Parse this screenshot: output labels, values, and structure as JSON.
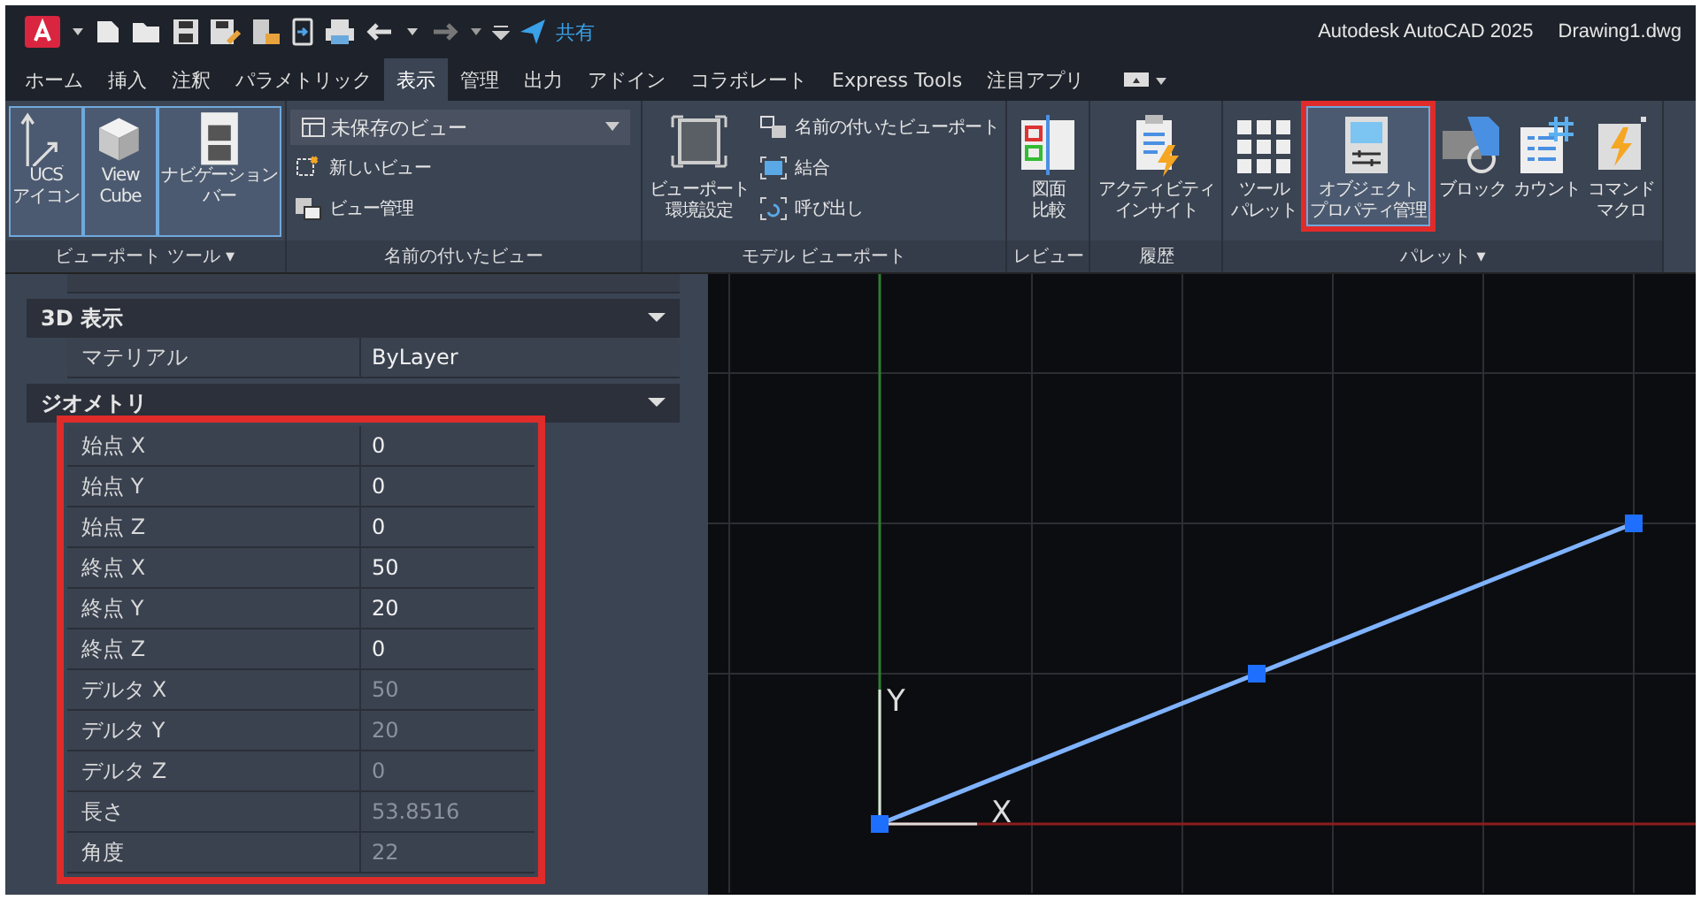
{
  "title_bar": {
    "share_label": "共有",
    "app_title": "Autodesk AutoCAD 2025",
    "document_title": "Drawing1.dwg"
  },
  "tabs": [
    {
      "label": "ホーム",
      "selected": false
    },
    {
      "label": "挿入",
      "selected": false
    },
    {
      "label": "注釈",
      "selected": false
    },
    {
      "label": "パラメトリック",
      "selected": false
    },
    {
      "label": "表示",
      "selected": true
    },
    {
      "label": "管理",
      "selected": false
    },
    {
      "label": "出力",
      "selected": false
    },
    {
      "label": "アドイン",
      "selected": false
    },
    {
      "label": "コラボレート",
      "selected": false
    },
    {
      "label": "Express Tools",
      "selected": false
    },
    {
      "label": "注目アプリ",
      "selected": false
    }
  ],
  "ribbon": {
    "groups": [
      {
        "title": "ビューポート ツール ▾",
        "kind": "large",
        "buttons": [
          {
            "label_lines": [
              "UCS",
              "アイコン"
            ],
            "on": true,
            "highlighted": false
          },
          {
            "label_lines": [
              "View",
              "Cube"
            ],
            "on": true,
            "highlighted": false
          },
          {
            "label_lines": [
              "ナビゲーション",
              "バー"
            ],
            "on": true,
            "highlighted": false
          }
        ]
      },
      {
        "title": "名前の付いたビュー",
        "kind": "views",
        "dropdown": "未保存のビュー",
        "small_buttons": [
          "新しいビュー",
          "ビュー管理"
        ]
      },
      {
        "title": "モデル ビューポート",
        "kind": "viewports",
        "large_button_lines": [
          "ビューポート",
          "環境設定"
        ],
        "small_buttons": [
          "名前の付いたビューポート",
          "結合",
          "呼び出し"
        ]
      },
      {
        "title": "レビュー",
        "kind": "large",
        "buttons": [
          {
            "label_lines": [
              "図面",
              "比較"
            ],
            "on": false,
            "highlighted": false
          }
        ]
      },
      {
        "title": "履歴",
        "kind": "large",
        "buttons": [
          {
            "label_lines": [
              "アクティビティ",
              "インサイト"
            ],
            "on": false,
            "highlighted": false
          }
        ]
      },
      {
        "title": "パレット ▾",
        "kind": "large",
        "buttons": [
          {
            "label_lines": [
              "ツール",
              "パレット"
            ],
            "on": false,
            "highlighted": false
          },
          {
            "label_lines": [
              "オブジェクト",
              "プロパティ管理"
            ],
            "on": true,
            "highlighted": true
          },
          {
            "label_lines": [
              "ブロック"
            ],
            "on": false,
            "highlighted": false
          },
          {
            "label_lines": [
              "カウント"
            ],
            "on": false,
            "highlighted": false
          },
          {
            "label_lines": [
              "コマンド",
              "マクロ"
            ],
            "on": false,
            "highlighted": false
          }
        ]
      }
    ]
  },
  "properties": {
    "sections": [
      {
        "title": "3D 表示",
        "highlighted": false,
        "rows": [
          {
            "label": "マテリアル",
            "value": "ByLayer",
            "readonly": false
          }
        ]
      },
      {
        "title": "ジオメトリ",
        "highlighted": true,
        "rows": [
          {
            "label": "始点 X",
            "value": "0",
            "readonly": false
          },
          {
            "label": "始点 Y",
            "value": "0",
            "readonly": false
          },
          {
            "label": "始点 Z",
            "value": "0",
            "readonly": false
          },
          {
            "label": "終点 X",
            "value": "50",
            "readonly": false
          },
          {
            "label": "終点 Y",
            "value": "20",
            "readonly": false
          },
          {
            "label": "終点 Z",
            "value": "0",
            "readonly": false
          },
          {
            "label": "デルタ X",
            "value": "50",
            "readonly": true
          },
          {
            "label": "デルタ Y",
            "value": "20",
            "readonly": true
          },
          {
            "label": "デルタ Z",
            "value": "0",
            "readonly": true
          },
          {
            "label": "長さ",
            "value": "53.8516",
            "readonly": true
          },
          {
            "label": "角度",
            "value": "22",
            "readonly": true
          }
        ]
      }
    ]
  },
  "canvas": {
    "y_axis_label": "Y",
    "x_axis_label": "X"
  }
}
